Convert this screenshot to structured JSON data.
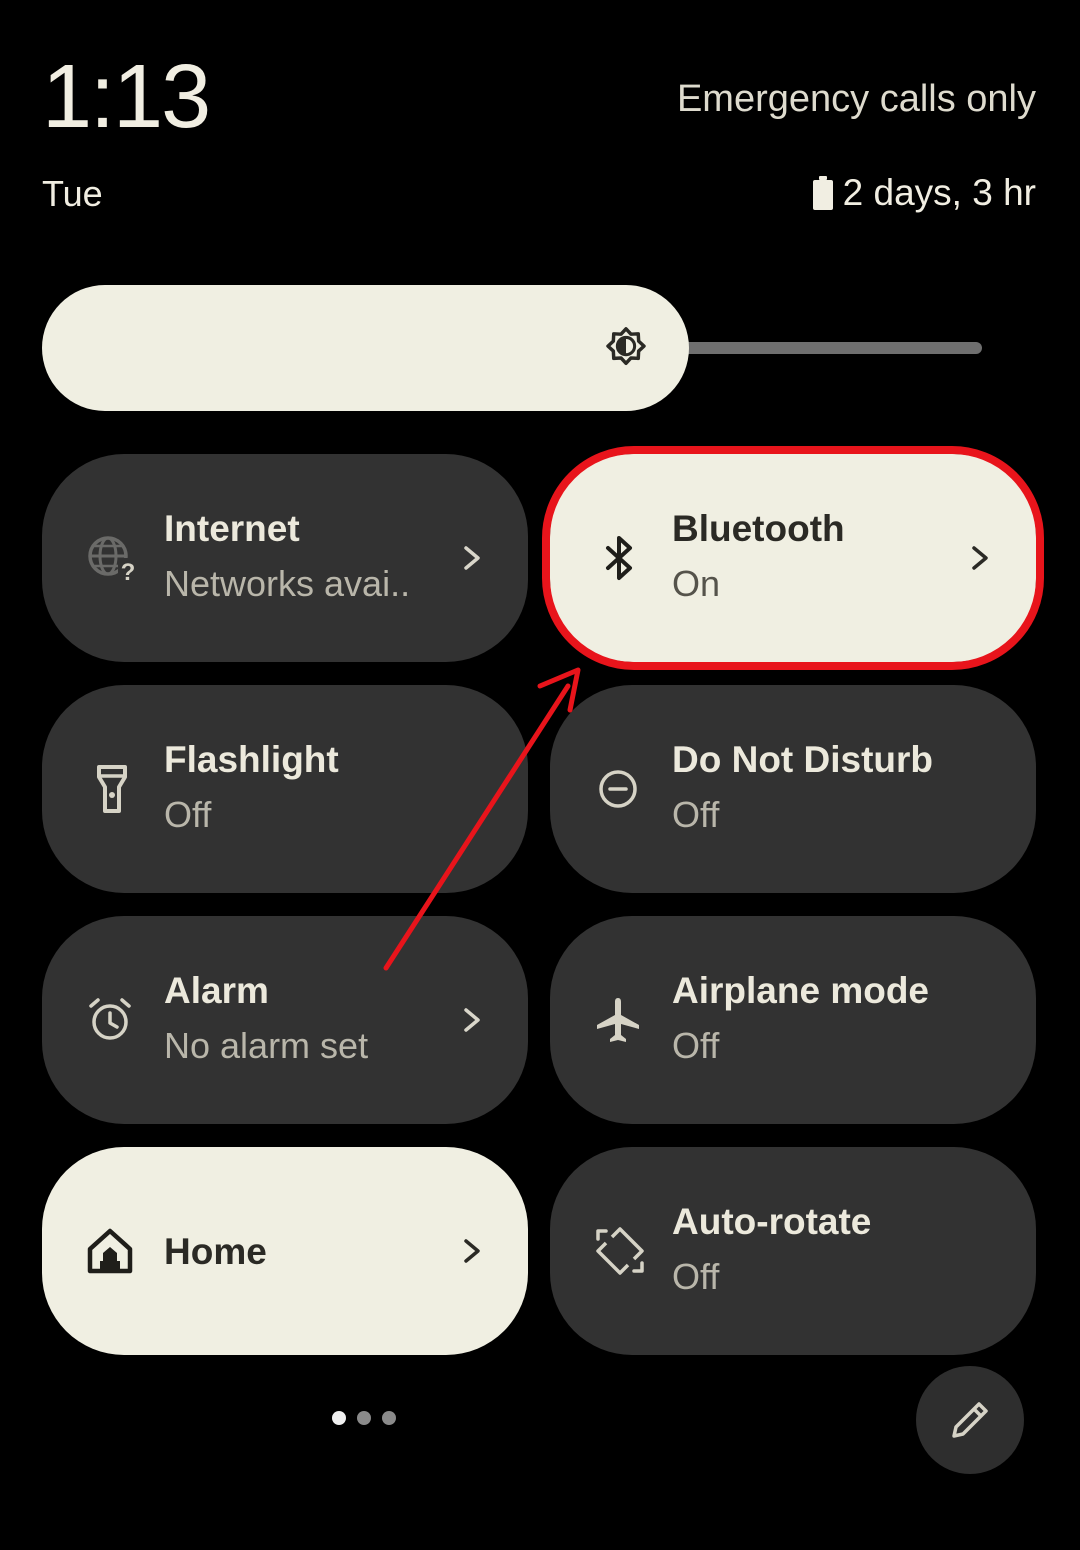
{
  "status": {
    "time": "1:13",
    "carrier": "Emergency calls only",
    "day": "Tue",
    "battery_text": "2 days, 3 hr",
    "battery_icon": "battery-icon"
  },
  "brightness": {
    "icon": "brightness-icon",
    "level_fraction": 0.64
  },
  "tiles": [
    {
      "id": "internet",
      "title": "Internet",
      "subtitle": "Networks avai..",
      "icon": "wifi-unknown-icon",
      "state": "off",
      "has_chevron": true
    },
    {
      "id": "bluetooth",
      "title": "Bluetooth",
      "subtitle": "On",
      "icon": "bluetooth-icon",
      "state": "on",
      "has_chevron": true
    },
    {
      "id": "flashlight",
      "title": "Flashlight",
      "subtitle": "Off",
      "icon": "flashlight-icon",
      "state": "off",
      "has_chevron": false
    },
    {
      "id": "dnd",
      "title": "Do Not Disturb",
      "subtitle": "Off",
      "icon": "do-not-disturb-icon",
      "state": "off",
      "has_chevron": false
    },
    {
      "id": "alarm",
      "title": "Alarm",
      "subtitle": "No alarm set",
      "icon": "alarm-clock-icon",
      "state": "off",
      "has_chevron": true
    },
    {
      "id": "airplane",
      "title": "Airplane mode",
      "subtitle": "Off",
      "icon": "airplane-icon",
      "state": "off",
      "has_chevron": false
    },
    {
      "id": "home",
      "title": "Home",
      "subtitle": "",
      "icon": "home-icon",
      "state": "on",
      "has_chevron": true
    },
    {
      "id": "autorotate",
      "title": "Auto-rotate",
      "subtitle": "Off",
      "icon": "auto-rotate-icon",
      "state": "off",
      "has_chevron": false
    }
  ],
  "pager": {
    "pages": 3,
    "current": 1
  },
  "edit_button": {
    "icon": "pencil-icon"
  },
  "colors": {
    "background": "#000000",
    "tile_off": "#323232",
    "tile_on": "#f0efe2",
    "annotation": "#e8141b"
  }
}
